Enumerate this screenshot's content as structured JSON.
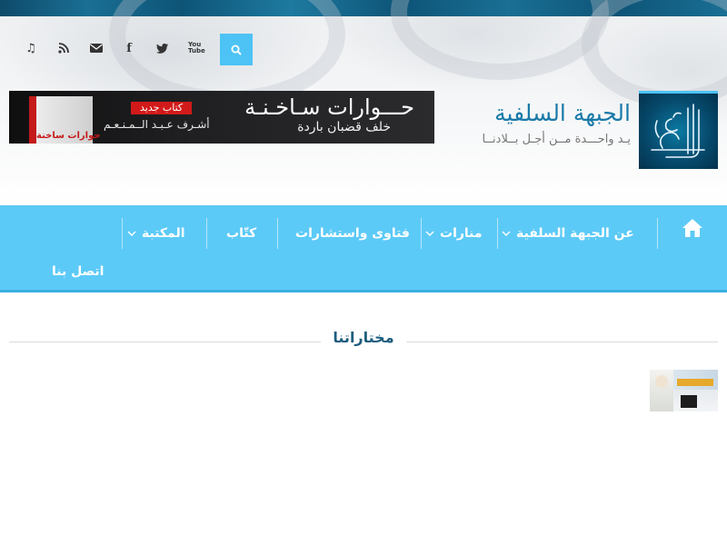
{
  "header": {
    "social": [
      {
        "icon": "music-icon",
        "glyph": "♫"
      },
      {
        "icon": "rss-icon",
        "glyph": "◉"
      },
      {
        "icon": "envelope-icon",
        "glyph": "✉"
      },
      {
        "icon": "facebook-icon",
        "glyph": "f"
      },
      {
        "icon": "twitter-icon",
        "glyph": "t"
      },
      {
        "icon": "youtube-icon",
        "glyph": "You Tube"
      }
    ],
    "search_icon": "search-icon"
  },
  "banner": {
    "main_title": "حـــوارات سـاخـنـة",
    "sub_title": "خلف قضبان باردة",
    "new_tag": "كتاب جديد",
    "supervised": "أشـرف عـبـد الــمـنـعـم",
    "book_title": "حوارات ساخنة"
  },
  "logo": {
    "title": "الجبهة السلفية",
    "tagline": "يـد واحـــدة مــن أجـل بــلادنــا"
  },
  "nav": {
    "items": [
      {
        "label": "عن الجبهة السلفية",
        "dropdown": true
      },
      {
        "label": "منارات",
        "dropdown": true
      },
      {
        "label": "فتاوى واستشارات",
        "dropdown": false
      },
      {
        "label": "كتّاب",
        "dropdown": false
      },
      {
        "label": "المكتبة",
        "dropdown": true
      }
    ],
    "contact": "اتصل بنا"
  },
  "featured": {
    "title": "مختاراتنا"
  },
  "colors": {
    "nav_bg": "#5ccaf7",
    "accent": "#4dc3f5",
    "logo_text": "#1a7aa8"
  }
}
